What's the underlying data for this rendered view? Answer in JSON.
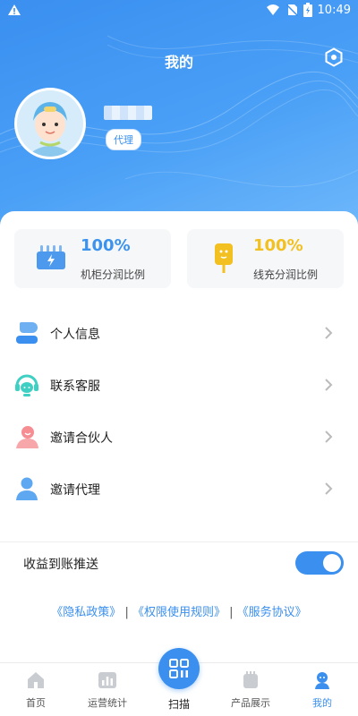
{
  "status_bar": {
    "time": "10:49"
  },
  "header": {
    "title": "我的",
    "role_badge": "代理"
  },
  "stats": [
    {
      "value": "100%",
      "label": "机柜分润比例",
      "icon": "cabinet-icon"
    },
    {
      "value": "100%",
      "label": "线充分润比例",
      "icon": "cable-charger-icon"
    }
  ],
  "menu": [
    {
      "label": "个人信息",
      "icon": "person-info-icon"
    },
    {
      "label": "联系客服",
      "icon": "headset-icon"
    },
    {
      "label": "邀请合伙人",
      "icon": "partner-icon"
    },
    {
      "label": "邀请代理",
      "icon": "agent-icon"
    }
  ],
  "push_setting": {
    "label": "收益到账推送",
    "enabled": true
  },
  "links": {
    "privacy": "《隐私政策》",
    "permissions": "《权限使用规则》",
    "service": "《服务协议》",
    "separator": "|"
  },
  "tabs": [
    {
      "label": "首页",
      "icon": "home-icon"
    },
    {
      "label": "运营统计",
      "icon": "stats-icon"
    },
    {
      "label": "扫描",
      "icon": "scan-icon"
    },
    {
      "label": "产品展示",
      "icon": "product-icon"
    },
    {
      "label": "我的",
      "icon": "profile-icon",
      "active": true
    }
  ],
  "colors": {
    "primary": "#3b8fee",
    "yellow": "#f2c021"
  }
}
